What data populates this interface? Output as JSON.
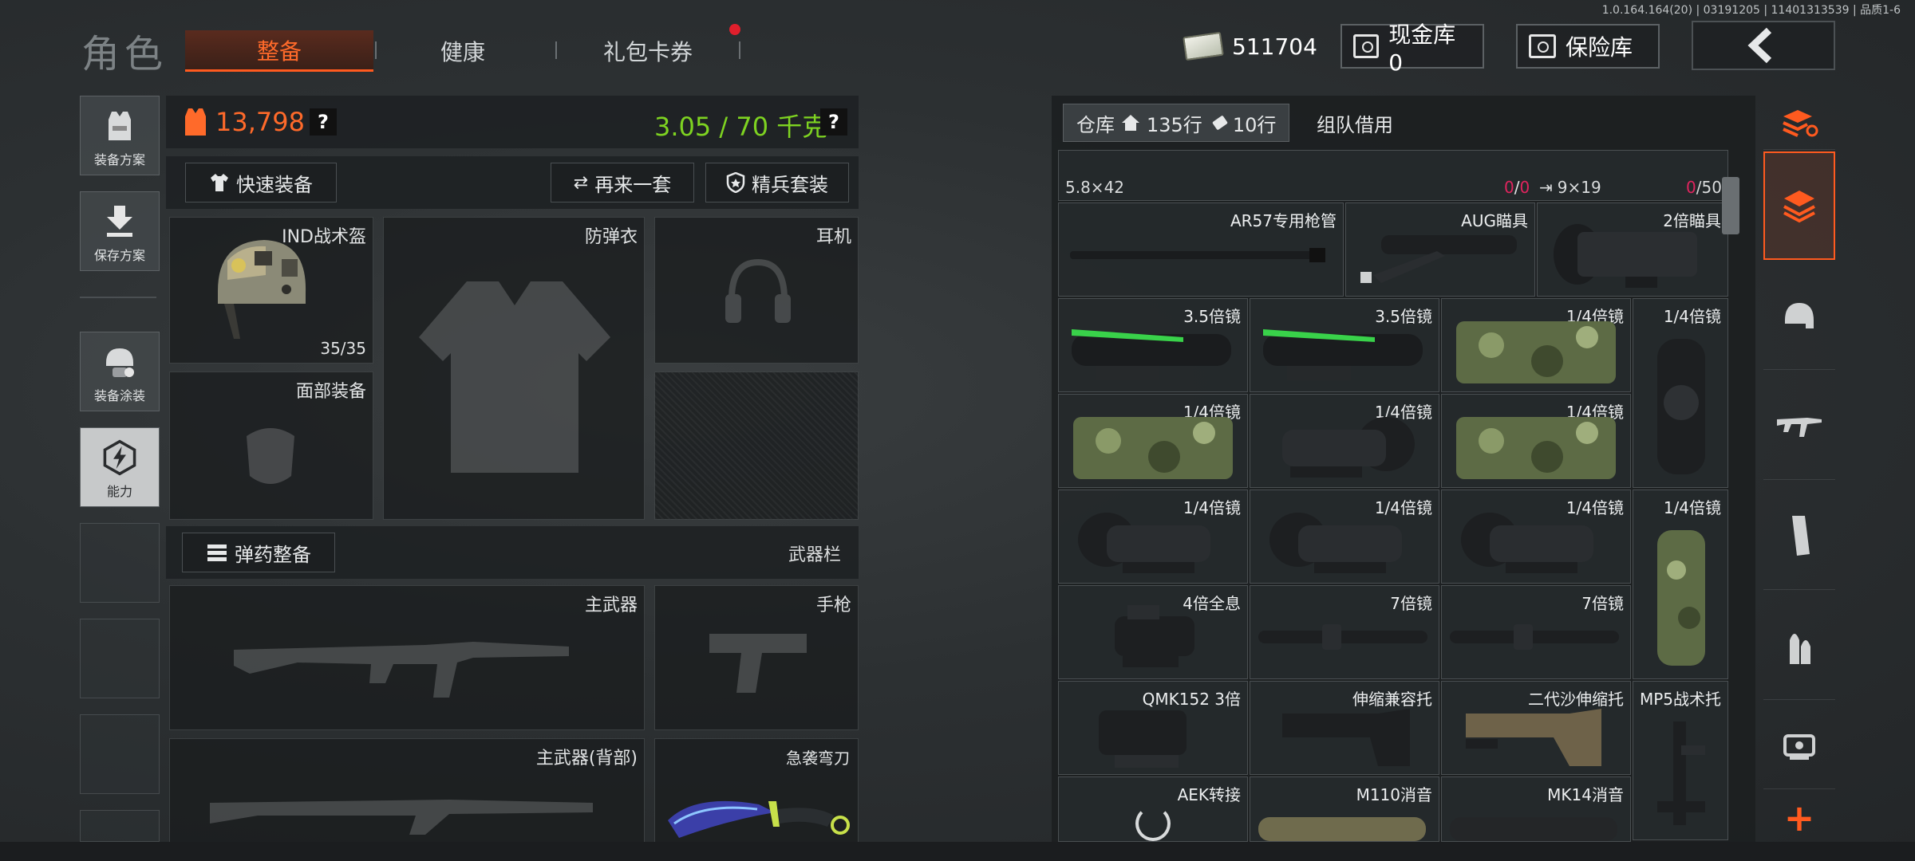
{
  "version": "1.0.164.164(20) | 03191205 | 11401313539 | 品质1-6",
  "header": {
    "title": "角色",
    "tabs": [
      {
        "label": "整备",
        "active": true
      },
      {
        "label": "健康",
        "active": false
      },
      {
        "label": "礼包卡券",
        "active": false,
        "badge": true
      }
    ],
    "money": "511704",
    "cash_vault": "现金库 0",
    "insurance": "保险库"
  },
  "sidebar": {
    "buttons": [
      {
        "label": "装备方案",
        "icon": "vest-icon"
      },
      {
        "label": "保存方案",
        "icon": "download-arrow-icon"
      },
      {
        "label": "装备涂装",
        "icon": "helmet-paint-icon"
      },
      {
        "label": "能力",
        "icon": "lightning-hex-icon"
      }
    ]
  },
  "equipment": {
    "value": "13,798",
    "weight": "3.05 / 70 千克",
    "help": "?",
    "quick_equip": "快速装备",
    "again": "再来一套",
    "elite": "精兵套装",
    "slots": {
      "helmet": {
        "label": "IND战术盔",
        "count": "35/35"
      },
      "armor": "防弹衣",
      "headset": "耳机",
      "face": "面部装备"
    },
    "ammo_button": "弹药整备",
    "weapon_bar": "武器栏",
    "weapons": {
      "primary": "主武器",
      "pistol": "手枪",
      "primary_back": "主武器(背部)",
      "melee": "急袭弯刀"
    }
  },
  "warehouse": {
    "tab_label": "仓库",
    "rows": "135行",
    "tickets": "10行",
    "team_tab": "组队借用",
    "top_row": {
      "left_ammo": "5.8×42",
      "left_count_a": "0",
      "left_slash": "/",
      "left_count_b": "0",
      "right_ammo": "9×19",
      "right_count_a": "0",
      "right_count_b": "/50"
    },
    "items": [
      "AR57专用枪管",
      "AUG瞄具",
      "2倍瞄具",
      "3.5倍镜",
      "3.5倍镜",
      "1/4倍镜",
      "1/4倍镜",
      "1/4倍镜",
      "1/4倍镜",
      "1/4倍镜",
      "1/4倍镜",
      "1/4倍镜",
      "1/4倍镜",
      "1/4倍镜",
      "4倍全息",
      "7倍镜",
      "7倍镜",
      "QMK152 3倍",
      "伸缩兼容托",
      "二代沙伸缩托",
      "MP5战术托",
      "AEK转接",
      "M110消音",
      "MK14消音"
    ]
  },
  "colors": {
    "accent": "#ff5a1f",
    "value_orange": "#ff6a2a",
    "weight_green": "#7ed321",
    "badge_red": "#e01f2c",
    "count_red": "#e0245e"
  }
}
